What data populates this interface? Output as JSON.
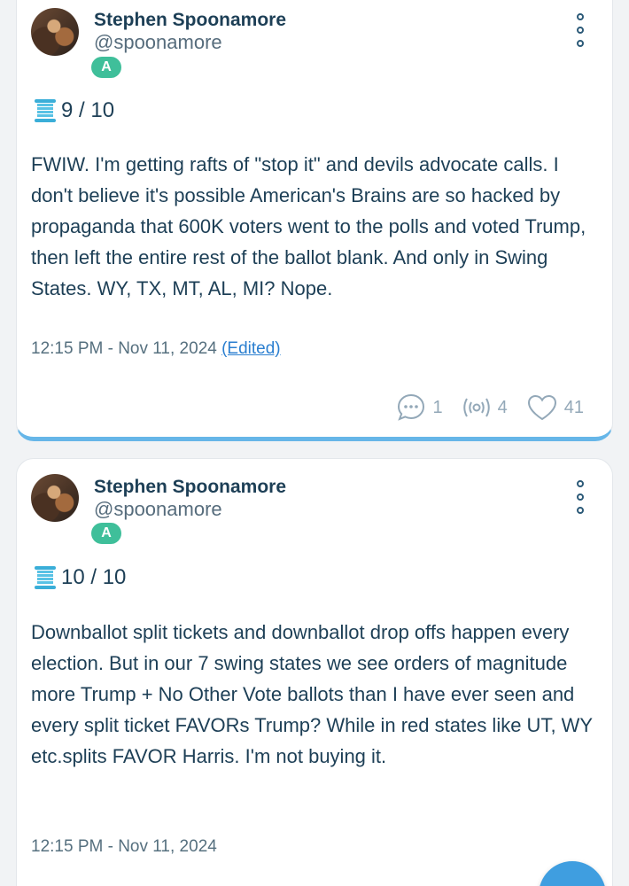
{
  "posts": [
    {
      "author_name": "Stephen Spoonamore",
      "author_handle": "@spoonamore",
      "badge": "A",
      "thread_position": "9 / 10",
      "body": "FWIW. I'm getting rafts of \"stop it\" and devils advocate calls. I don't believe it's possible American's Brains are so hacked by propaganda that 600K voters went to the polls and voted Trump, then left the entire rest of the ballot blank. And only in Swing States. WY, TX, MT, AL, MI? Nope.",
      "timestamp": "12:15 PM - Nov 11, 2024",
      "edited_label": "(Edited)",
      "comments": "1",
      "reposts": "4",
      "likes": "41"
    },
    {
      "author_name": "Stephen Spoonamore",
      "author_handle": "@spoonamore",
      "badge": "A",
      "thread_position": "10 / 10",
      "body": "Downballot split tickets and downballot drop offs happen every election. But in our 7 swing states we see orders of magnitude more Trump + No Other Vote ballots than I have ever seen and every split ticket FAVORs Trump? While in red states like UT, WY etc.splits FAVOR Harris. I'm not buying it.",
      "timestamp": "12:15 PM - Nov 11, 2024"
    }
  ],
  "colors": {
    "badge": "#3fbf9a",
    "accent_bar": "#66b6e8",
    "link": "#2b7fd0",
    "text": "#1d3f56",
    "muted": "#93a8b8",
    "fab": "#3f9ee0"
  },
  "icons": {
    "thread": "spool-icon",
    "menu": "vertical-dots-icon",
    "comment": "speech-bubble-icon",
    "repost": "broadcast-icon",
    "like": "heart-icon"
  }
}
